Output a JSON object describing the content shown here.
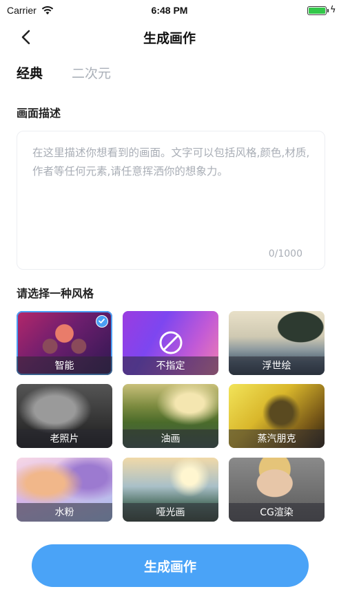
{
  "status_bar": {
    "carrier": "Carrier",
    "time": "6:48 PM"
  },
  "nav": {
    "title": "生成画作",
    "back_icon": "chevron-left-icon"
  },
  "tabs": [
    {
      "label": "经典",
      "active": true
    },
    {
      "label": "二次元",
      "active": false
    }
  ],
  "description": {
    "section_label": "画面描述",
    "placeholder": "在这里描述你想看到的画面。文字可以包括风格,颜色,材质,作者等任何元素,请任意挥洒你的想象力。",
    "value": "",
    "counter": "0/1000"
  },
  "styles": {
    "section_label": "请选择一种风格",
    "items": [
      {
        "label": "智能",
        "selected": true
      },
      {
        "label": "不指定",
        "selected": false
      },
      {
        "label": "浮世绘",
        "selected": false
      },
      {
        "label": "老照片",
        "selected": false
      },
      {
        "label": "油画",
        "selected": false
      },
      {
        "label": "蒸汽朋克",
        "selected": false
      },
      {
        "label": "水粉",
        "selected": false
      },
      {
        "label": "哑光画",
        "selected": false
      },
      {
        "label": "CG渲染",
        "selected": false
      }
    ]
  },
  "actions": {
    "generate_label": "生成画作"
  },
  "colors": {
    "accent": "#4aa3f7",
    "tab_highlight": "#f5d43a",
    "battery": "#33c84a"
  }
}
